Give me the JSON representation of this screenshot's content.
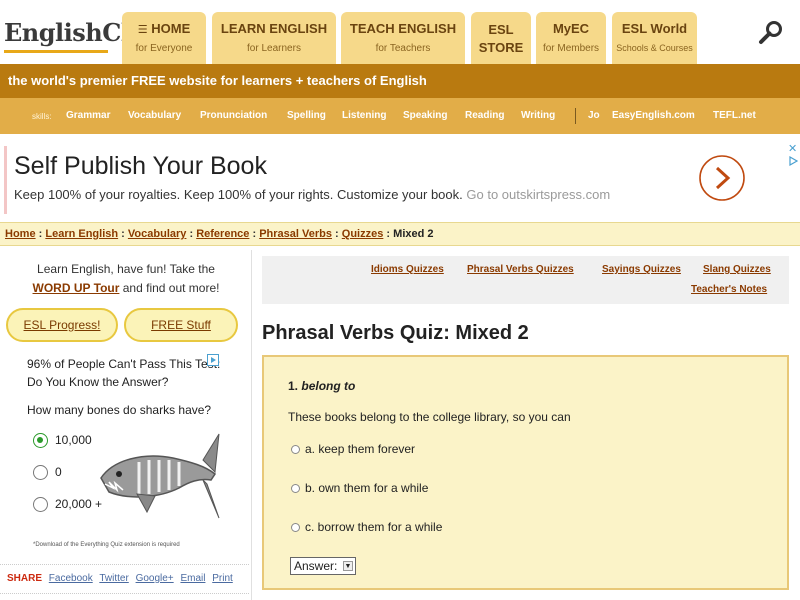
{
  "header": {
    "logo": "EnglishClub",
    "nav": [
      {
        "title": "HOME",
        "sub": "for Everyone"
      },
      {
        "title": "LEARN ENGLISH",
        "sub": "for Learners"
      },
      {
        "title": "TEACH ENGLISH",
        "sub": "for Teachers"
      },
      {
        "title": "ESL",
        "title2": "STORE"
      },
      {
        "title": "MyEC",
        "sub": "for Members"
      },
      {
        "title": "ESL World",
        "sub": "Schools & Courses"
      }
    ]
  },
  "tagline": "the world's premier FREE website for learners + teachers of English",
  "skills": {
    "label": "skills:",
    "items": [
      "Grammar",
      "Vocabulary",
      "Pronunciation",
      "Spelling",
      "Listening",
      "Speaking",
      "Reading",
      "Writing"
    ],
    "extra": [
      "Jo",
      "EasyEnglish.com",
      "TEFL.net"
    ]
  },
  "ad": {
    "title": "Self Publish Your Book",
    "text": "Keep 100% of your royalties. Keep 100% of your rights. Customize your book.",
    "domain": "Go to outskirtspress.com",
    "close": "✕"
  },
  "breadcrumb": {
    "items": [
      "Home",
      "Learn English",
      "Vocabulary",
      "Reference",
      "Phrasal Verbs",
      "Quizzes"
    ],
    "current": "Mixed 2",
    "sep": ":"
  },
  "left": {
    "promo_text_1": "Learn English, have fun! Take the",
    "promo_link": "WORD UP Tour",
    "promo_text_2": "and find out more!",
    "pill_left": "ESL Progress!",
    "pill_right": "FREE Stuff",
    "quizad_title": "96% of People Can't Pass This Test: Do You Know the Answer?",
    "quizad_question": "How many bones do sharks have?",
    "options": [
      "10,000",
      "0",
      "20,000 +"
    ],
    "selected": 0,
    "footnote": "*Download of the Everything Quiz extension is required",
    "share_label": "SHARE",
    "share_links": [
      "Facebook",
      "Twitter",
      "Google+",
      "Email",
      "Print"
    ]
  },
  "quizlinks": [
    "Idioms Quizzes",
    "Phrasal Verbs Quizzes",
    "Sayings Quizzes",
    "Slang Quizzes",
    "Teacher's Notes"
  ],
  "page_title": "Phrasal Verbs Quiz: Mixed 2",
  "question": {
    "number": "1.",
    "phrase": "belong to",
    "prompt": "These books belong to the college library, so you can",
    "options": [
      "a. keep them forever",
      "b. own them for a while",
      "c. borrow them for a while"
    ],
    "answer_label": "Answer:"
  },
  "colors": {
    "tab": "#f6d98a",
    "tagline": "#b97a10",
    "skills": "#e2ad48",
    "link": "#8a3a00",
    "quiz_bg": "#fbf3c8"
  }
}
